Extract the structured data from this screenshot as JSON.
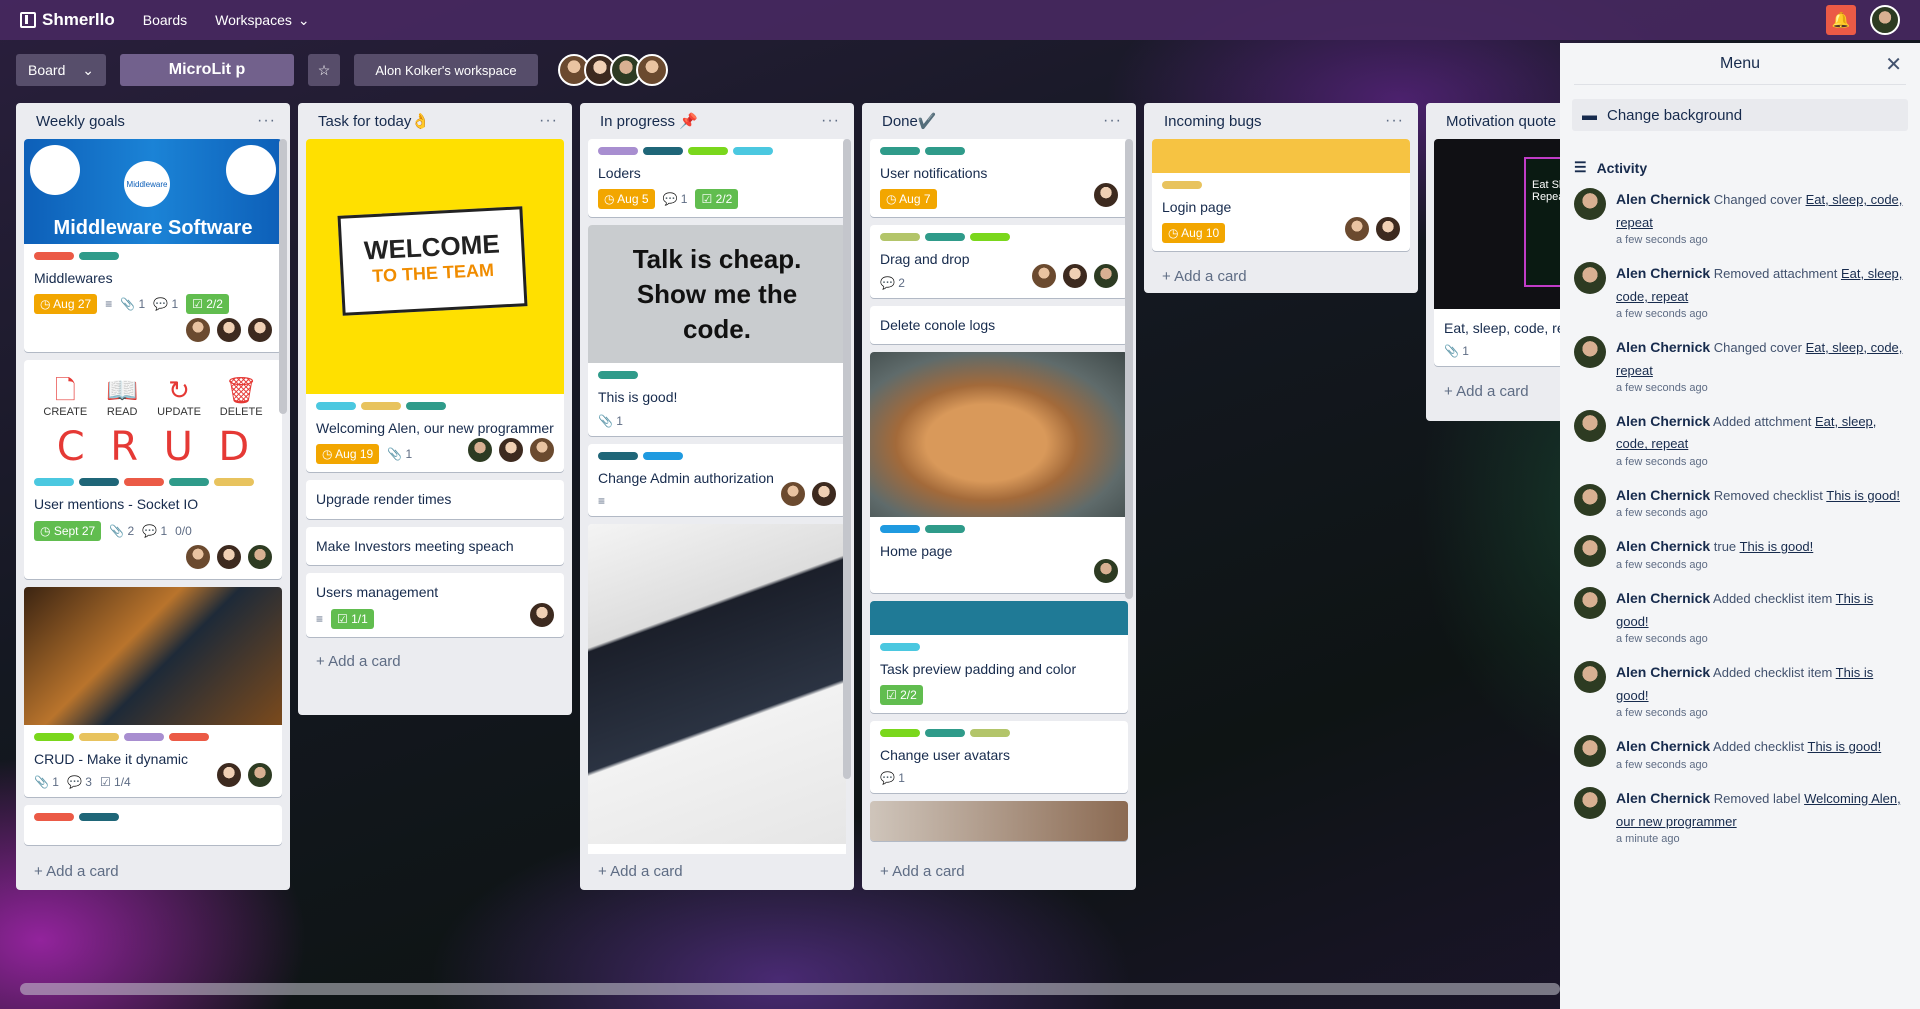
{
  "app": {
    "name": "Shmerllo",
    "nav_boards": "Boards",
    "nav_workspaces": "Workspaces",
    "notif_icon": "bell-icon"
  },
  "board": {
    "view_label": "Board",
    "title": "MicroLit p",
    "workspace": "Alon Kolker's workspace"
  },
  "lists": [
    {
      "title": "Weekly goals",
      "add": "+ Add a card",
      "cards": [
        {
          "cover": "Middleware Software",
          "cover_sub": "Middleware",
          "title": "Middlewares",
          "due": "Aug 27",
          "attach": "1",
          "comments": "1",
          "checklist": "2/2"
        },
        {
          "crud_labels": [
            "CREATE",
            "READ",
            "UPDATE",
            "DELETE"
          ],
          "crud_letters": [
            "C",
            "R",
            "U",
            "D"
          ],
          "title": "User mentions - Socket IO",
          "due": "Sept 27",
          "attach": "2",
          "comments": "1",
          "extra": "0/0"
        },
        {
          "title": "CRUD - Make it dynamic",
          "attach": "1",
          "comments": "3",
          "checklist": "1/4"
        }
      ]
    },
    {
      "title": "Task for today👌",
      "add": "+ Add a card",
      "cards": [
        {
          "cover_line1": "WELCOME",
          "cover_line2": "TO THE TEAM",
          "title": "Welcoming Alen, our new programmer",
          "due": "Aug 19",
          "attach": "1"
        },
        {
          "title": "Upgrade render times"
        },
        {
          "title": "Make Investors meeting speach"
        },
        {
          "title": "Users management",
          "checklist": "1/1"
        }
      ]
    },
    {
      "title": "In progress 📌",
      "add": "+ Add a card",
      "cards": [
        {
          "title": "Loders",
          "due": "Aug 5",
          "comments": "1",
          "checklist": "2/2"
        },
        {
          "cover_quote": "Talk is cheap. Show me the code.",
          "title": "This is good!",
          "attach": "1"
        },
        {
          "title": "Change Admin authorization"
        }
      ]
    },
    {
      "title": "Done✔️",
      "add": "+ Add a card",
      "cards": [
        {
          "title": "User notifications",
          "due": "Aug 7"
        },
        {
          "title": "Drag and drop",
          "comments": "2"
        },
        {
          "title": "Delete conole logs"
        },
        {
          "title": "Home page"
        },
        {
          "title": "Task preview padding and color",
          "checklist": "2/2"
        },
        {
          "title": "Change user avatars",
          "comments": "1"
        }
      ]
    },
    {
      "title": "Incoming bugs",
      "add": "+ Add a card",
      "cards": [
        {
          "title": "Login page",
          "due": "Aug 10"
        }
      ]
    },
    {
      "title": "Motivation quote",
      "add": "+ Add a card",
      "cards": [
        {
          "cover_text": "Eat Sleep Code Repeat",
          "title": "Eat, sleep, code, re",
          "attach": "1"
        }
      ]
    }
  ],
  "menu": {
    "title": "Menu",
    "change_bg": "Change background",
    "activity": "Activity",
    "items": [
      {
        "user": "Alen Chernick",
        "action": "Changed cover",
        "target": "Eat, sleep, code, repeat",
        "time": "a few seconds ago"
      },
      {
        "user": "Alen Chernick",
        "action": "Removed attachment",
        "target": "Eat, sleep, code, repeat",
        "time": "a few seconds ago"
      },
      {
        "user": "Alen Chernick",
        "action": "Changed cover",
        "target": "Eat, sleep, code, repeat",
        "time": "a few seconds ago"
      },
      {
        "user": "Alen Chernick",
        "action": "Added attchment",
        "target": "Eat, sleep, code, repeat",
        "time": "a few seconds ago"
      },
      {
        "user": "Alen Chernick",
        "action": "Removed checklist",
        "target": "This is good!",
        "time": "a few seconds ago"
      },
      {
        "user": "Alen Chernick",
        "action": "true",
        "target": "This is good!",
        "time": "a few seconds ago"
      },
      {
        "user": "Alen Chernick",
        "action": "Added checklist item",
        "target": "This is good!",
        "time": "a few seconds ago"
      },
      {
        "user": "Alen Chernick",
        "action": "Added checklist item",
        "target": "This is good!",
        "time": "a few seconds ago"
      },
      {
        "user": "Alen Chernick",
        "action": "Added checklist",
        "target": "This is good!",
        "time": "a few seconds ago"
      },
      {
        "user": "Alen Chernick",
        "action": "Removed label",
        "target": "Welcoming Alen, our new programmer",
        "time": "a minute ago"
      }
    ]
  },
  "colors": {
    "topbar": "#46285f",
    "due": "#f2a600",
    "green": "#61bd4f",
    "red": "#eb5a46",
    "teal": "#2f9b8a",
    "sky": "#4bc8e0",
    "lime": "#7ad71c",
    "purple": "#a88ed0",
    "yellow": "#e8c35e",
    "navy": "#1f6678",
    "blue": "#1f9ae0"
  }
}
